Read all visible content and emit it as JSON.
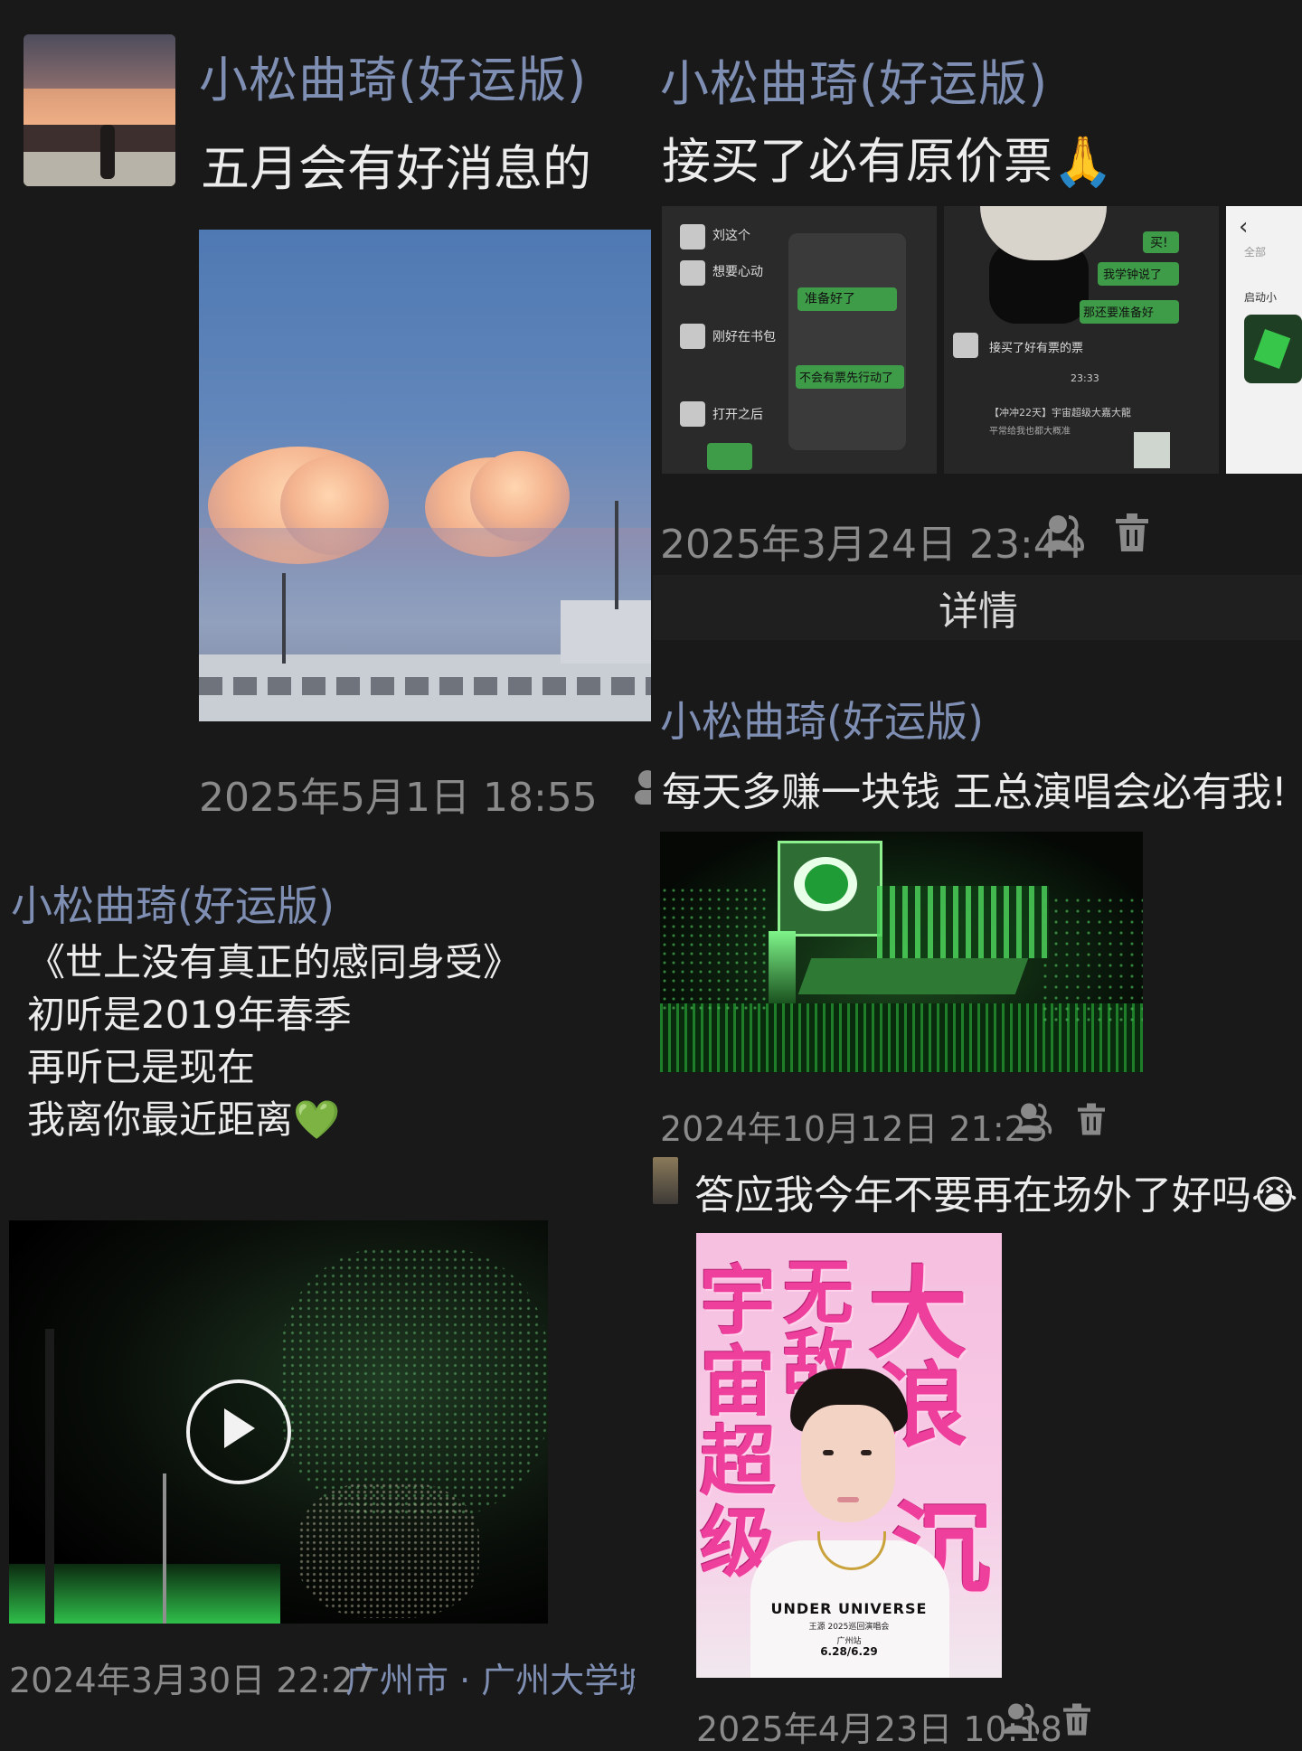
{
  "colors": {
    "background": "#191919",
    "name": "#7f8fb3",
    "text": "#ececec",
    "meta": "#8a8a8a"
  },
  "posts": [
    {
      "author": "小松曲琦(好运版)",
      "text": "五月会有好消息的",
      "time": "2025年5月1日 18:55"
    },
    {
      "author": "小松曲琦(好运版)",
      "text": "接买了必有原价票🙏",
      "time": "2025年3月24日 23:44",
      "details_label": "详情",
      "shot_texts": [
        "刘这个",
        "想要心动",
        "刚好在书包",
        "打开之后",
        "准备好了",
        "不会有票先行动了",
        "买!",
        "我学钟说了",
        "那还要准备好",
        "接买了好有票的票",
        "23:33",
        "【冲冲22天】宇宙超级大嘉大龍",
        "平常给我也都大概准",
        "全部",
        "启动小"
      ]
    },
    {
      "author": "小松曲琦(好运版)",
      "text": "每天多赚一块钱 王总演唱会必有我!",
      "time": "2024年10月12日 21:23"
    },
    {
      "author": "小松曲琦(好运版)",
      "poem": [
        "《世上没有真正的感同身受》",
        "初听是2019年春季",
        "再听已是现在",
        "我离你最近距离💚"
      ],
      "time": "2024年3月30日 22:27",
      "location": "广州市 · 广州大学城"
    },
    {
      "text": "答应我今年不要再在场外了好吗😭",
      "time": "2025年4月23日 10:18",
      "poster": {
        "chars": [
          "宇",
          "宙",
          "超",
          "级",
          "无",
          "敌",
          "大",
          "浪",
          "沉"
        ],
        "title": "UNDER UNIVERSE",
        "subtitle": "王源 2025巡回演唱会",
        "city": "广州站",
        "dates": "6.28/6.29"
      }
    }
  ],
  "icons": {
    "person": "person-icon",
    "trash": "trash-icon",
    "play": "play-icon"
  }
}
